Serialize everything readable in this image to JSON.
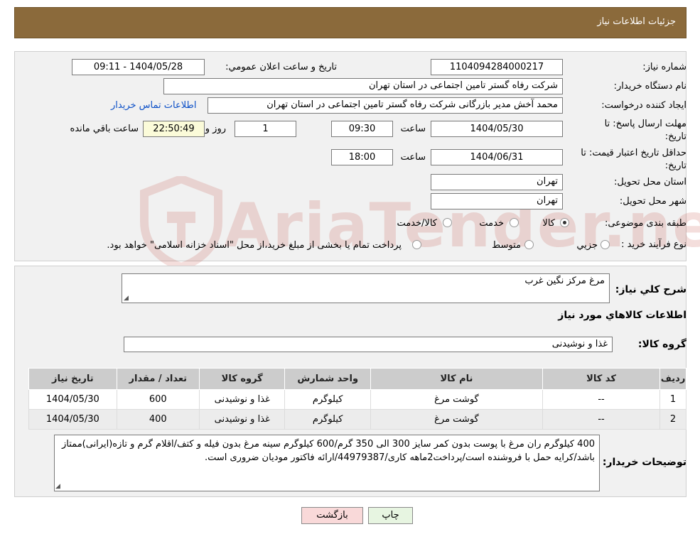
{
  "header": {
    "title": "جزئیات اطلاعات نیاز"
  },
  "form": {
    "need_number_label": "شماره نیاز:",
    "need_number": "1104094284000217",
    "announce_label": "تاريخ و ساعت اعلان عمومي:",
    "announce_value": "1404/05/28 - 09:11",
    "buyer_org_label": "نام دستگاه خريدار:",
    "buyer_org": "شرکت رفاه گستر تامین اجتماعی در استان تهران",
    "creator_label": "ايجاد کننده درخواست:",
    "creator": "محمد آخش مدیر بازرگانی شرکت رفاه گستر تامین اجتماعی در استان تهران",
    "contact_link": "اطلاعات تماس خريدار",
    "deadline_label_1": "مهلت ارسال پاسخ: تا",
    "deadline_label_2": "تاريخ:",
    "deadline_date": "1404/05/30",
    "time_label": "ساعت",
    "deadline_time": "09:30",
    "days_value": "1",
    "days_label": "روز و",
    "remaining_value": "22:50:49",
    "remaining_label": "ساعت باقي مانده",
    "validity_label_1": "حداقل تاريخ اعتبار قيمت: تا",
    "validity_label_2": "تاريخ:",
    "validity_date": "1404/06/31",
    "validity_time": "18:00",
    "province_label": "استان محل تحويل:",
    "province": "تهران",
    "city_label": "شهر محل تحويل:",
    "city": "تهران",
    "category_label": "طبقه بندی موضوعی:",
    "category_options": [
      "کالا",
      "خدمت",
      "کالا/خدمت"
    ],
    "category_selected": "کالا",
    "purchase_type_label": "نوع فرآيند خريد :",
    "purchase_options": [
      "جزيي",
      "متوسط"
    ],
    "purchase_note": "پرداخت تمام يا بخشی از مبلغ خريد،از محل \"اسناد خزانه اسلامی\" خواهد بود."
  },
  "summary": {
    "general_desc_label": "شرح کلي نياز:",
    "general_desc": "مرغ مرکز نگین غرب",
    "goods_info_title": "اطلاعات کالاهاي مورد نياز",
    "goods_group_label": "گروه کالا:",
    "goods_group": "غذا و نوشیدنی"
  },
  "table": {
    "headers": [
      "رديف",
      "کد کالا",
      "نام کالا",
      "واحد شمارش",
      "گروه کالا",
      "تعداد / مقدار",
      "تاريخ نياز"
    ],
    "rows": [
      [
        "1",
        "--",
        "گوشت مرغ",
        "کیلوگرم",
        "غذا و نوشیدنی",
        "600",
        "1404/05/30"
      ],
      [
        "2",
        "--",
        "گوشت مرغ",
        "کیلوگرم",
        "غذا و نوشیدنی",
        "400",
        "1404/05/30"
      ]
    ]
  },
  "buyer_notes": {
    "label": "توضيحات خريدار:",
    "text": "400 کیلوگرم ران مرغ با پوست بدون کمر سایز 300 الی 350 گرم/600 کیلوگرم سینه مرغ بدون فیله و کتف/اقلام گرم و تازه(ایرانی)ممتاز باشد/کرایه حمل با فروشنده است/پرداخت2ماهه کاری/44979387/ارائه فاکتور مودیان ضروری است."
  },
  "buttons": {
    "print": "چاپ",
    "back": "بازگشت"
  },
  "colors": {
    "header_bg": "#8b6a3b",
    "link": "#0b4fc7",
    "back_btn": "#f9d9d9",
    "print_btn": "#e7f5e1"
  }
}
